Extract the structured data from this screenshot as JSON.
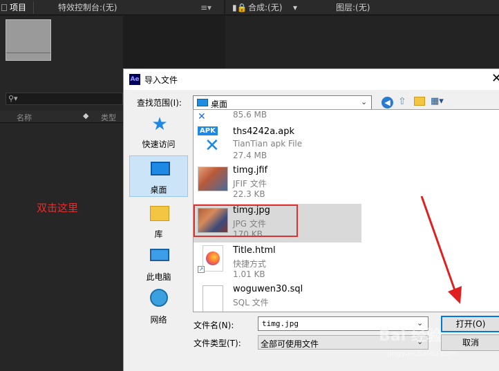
{
  "ae": {
    "tab_project": "项目",
    "tab_effects": "特效控制台:(无)",
    "tab_comp": "合成:(无)",
    "tab_layer": "图层:(无)",
    "col_name": "名称",
    "col_type": "类型",
    "annotation": "双击这里"
  },
  "dialog": {
    "title": "导入文件",
    "app_icon": "Ae",
    "lookin_label": "查找范围(I):",
    "lookin_value": "桌面",
    "places": [
      {
        "label": "快速访问",
        "icon": "star-icon"
      },
      {
        "label": "桌面",
        "icon": "desktop-icon"
      },
      {
        "label": "库",
        "icon": "library-icon"
      },
      {
        "label": "此电脑",
        "icon": "computer-icon"
      },
      {
        "label": "网络",
        "icon": "network-icon"
      }
    ],
    "files": [
      {
        "name": "",
        "type": "",
        "size": "85.6 MB"
      },
      {
        "name": "ths4242a.apk",
        "type": "TianTian apk File",
        "size": "27.4 MB",
        "badge": "APK"
      },
      {
        "name": "timg.jfif",
        "type": "JFIF 文件",
        "size": "22.3 KB"
      },
      {
        "name": "timg.jpg",
        "type": "JPG 文件",
        "size": "170 KB"
      },
      {
        "name": "Title.html",
        "type": "快捷方式",
        "size": "1.01 KB"
      },
      {
        "name": "woguwen30.sql",
        "type": "SQL 文件",
        "size": ""
      }
    ],
    "filename_label": "文件名(N):",
    "filename_value": "timg.jpg",
    "filetype_label": "文件类型(T):",
    "filetype_value": "全部可使用文件",
    "open_button": "打开(O)",
    "cancel_button": "取消"
  },
  "watermark": {
    "text": "Bai 经验",
    "sub": "jingyan.baidu.com"
  },
  "colors": {
    "highlight": "#e03030",
    "selection": "#d9d9d9",
    "arrow": "#e02020"
  }
}
